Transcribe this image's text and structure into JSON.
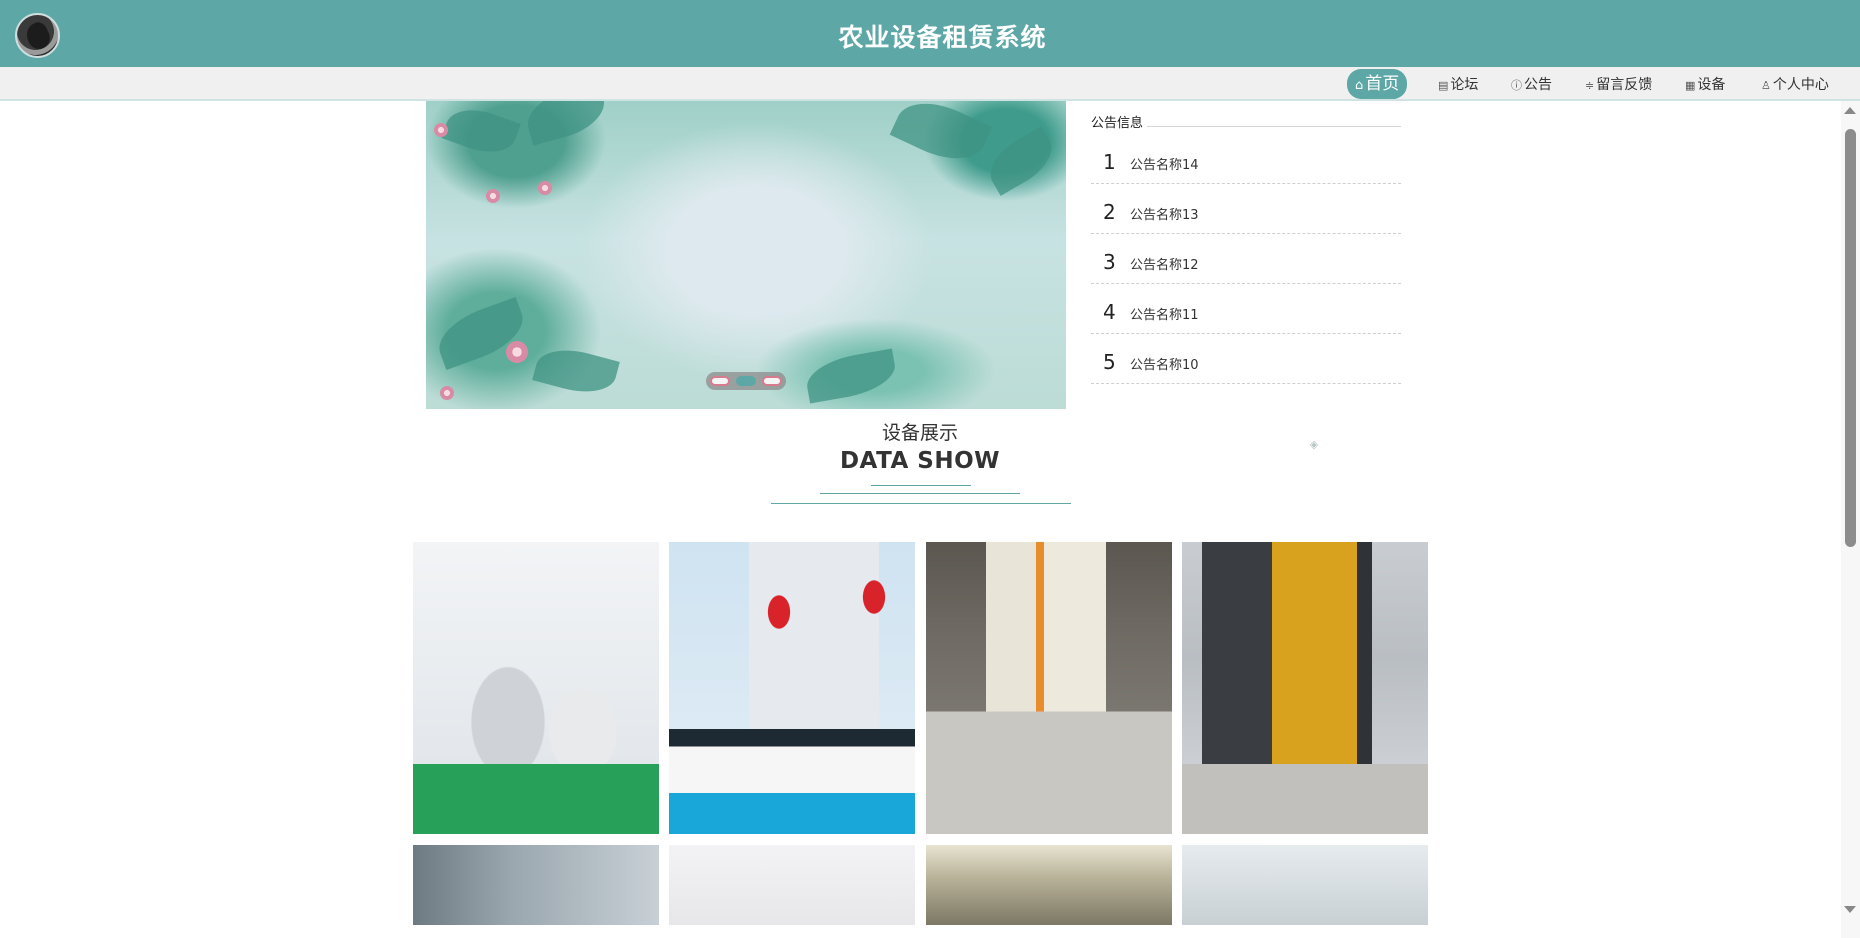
{
  "header": {
    "logo_icon": "shark-logo-icon",
    "title": "农业设备租赁系统",
    "background_color": "#5ea7a7"
  },
  "nav": {
    "items": [
      {
        "label": "首页",
        "icon": "home-icon",
        "active": true
      },
      {
        "label": "论坛",
        "icon": "forum-icon",
        "active": false
      },
      {
        "label": "公告",
        "icon": "notice-icon",
        "active": false
      },
      {
        "label": "留言反馈",
        "icon": "feedback-icon",
        "active": false
      },
      {
        "label": "设备",
        "icon": "device-icon",
        "active": false
      },
      {
        "label": "个人中心",
        "icon": "user-icon",
        "active": false
      }
    ]
  },
  "carousel": {
    "slide_count": 3,
    "active_index": 2
  },
  "notice": {
    "title": "公告信息",
    "items": [
      {
        "num": "1",
        "name": "公告名称14"
      },
      {
        "num": "2",
        "name": "公告名称13"
      },
      {
        "num": "3",
        "name": "公告名称12"
      },
      {
        "num": "4",
        "name": "公告名称11"
      },
      {
        "num": "5",
        "name": "公告名称10"
      }
    ]
  },
  "section": {
    "title": "设备展示",
    "subtitle": "DATA SHOW"
  },
  "gallery": {
    "items": [
      {
        "icon": "equipment-photo-production-line"
      },
      {
        "icon": "equipment-photo-lab-bench"
      },
      {
        "icon": "equipment-photo-spray-booth"
      },
      {
        "icon": "equipment-photo-exhaust-unit"
      },
      {
        "icon": "equipment-photo-tank"
      },
      {
        "icon": "equipment-photo-glassware"
      },
      {
        "icon": "equipment-photo-factory-frame"
      },
      {
        "icon": "equipment-photo-clean-room"
      }
    ]
  }
}
